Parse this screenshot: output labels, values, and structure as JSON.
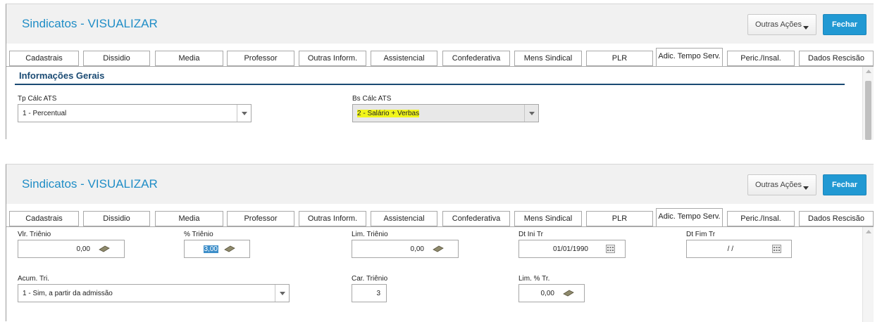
{
  "title": "Sindicatos - VISUALIZAR",
  "outras_acoes_label": "Outras Ações",
  "fechar_label": "Fechar",
  "tabs": [
    {
      "label": "Cadastrais"
    },
    {
      "label": "Dissidio"
    },
    {
      "label": "Media"
    },
    {
      "label": "Professor"
    },
    {
      "label": "Outras Inform."
    },
    {
      "label": "Assistencial"
    },
    {
      "label": "Confederativa"
    },
    {
      "label": "Mens Sindical"
    },
    {
      "label": "PLR"
    },
    {
      "label": "Adic. Tempo Serv."
    },
    {
      "label": "Peric./Insal."
    },
    {
      "label": "Dados Rescisão"
    }
  ],
  "active_tab": "Adic. Tempo Serv.",
  "panel1": {
    "section_title": "Informações Gerais",
    "tp_calc_ats": {
      "label": "Tp Cálc ATS",
      "value": "1 - Percentual"
    },
    "bs_calc_ats": {
      "label": "Bs Cálc ATS",
      "value": "2 - Salário + Verbas"
    }
  },
  "panel2": {
    "vlr_trienio": {
      "label": "Vlr. Triênio",
      "value": "0,00"
    },
    "pct_trienio": {
      "label": "% Triênio",
      "value": "3,00"
    },
    "lim_trienio": {
      "label": "Lim. Triênio",
      "value": "0,00"
    },
    "dt_ini_tr": {
      "label": "Dt Ini Tr",
      "value": "01/01/1990"
    },
    "dt_fim_tr": {
      "label": "Dt Fim Tr",
      "value": "/ /"
    },
    "acum_tri": {
      "label": "Acum. Tri.",
      "value": "1 - Sim, a partir da admissão"
    },
    "car_trienio": {
      "label": "Car. Triênio",
      "value": "3"
    },
    "lim_pct_tr": {
      "label": "Lim. % Tr.",
      "value": "0,00"
    }
  },
  "colors": {
    "accent": "#1f8dc6",
    "button": "#2199d3",
    "section": "#1a4a73",
    "highlight": "#f1f51a"
  },
  "icons": [
    "money-icon",
    "calendar-icon",
    "chevron-down-icon"
  ]
}
